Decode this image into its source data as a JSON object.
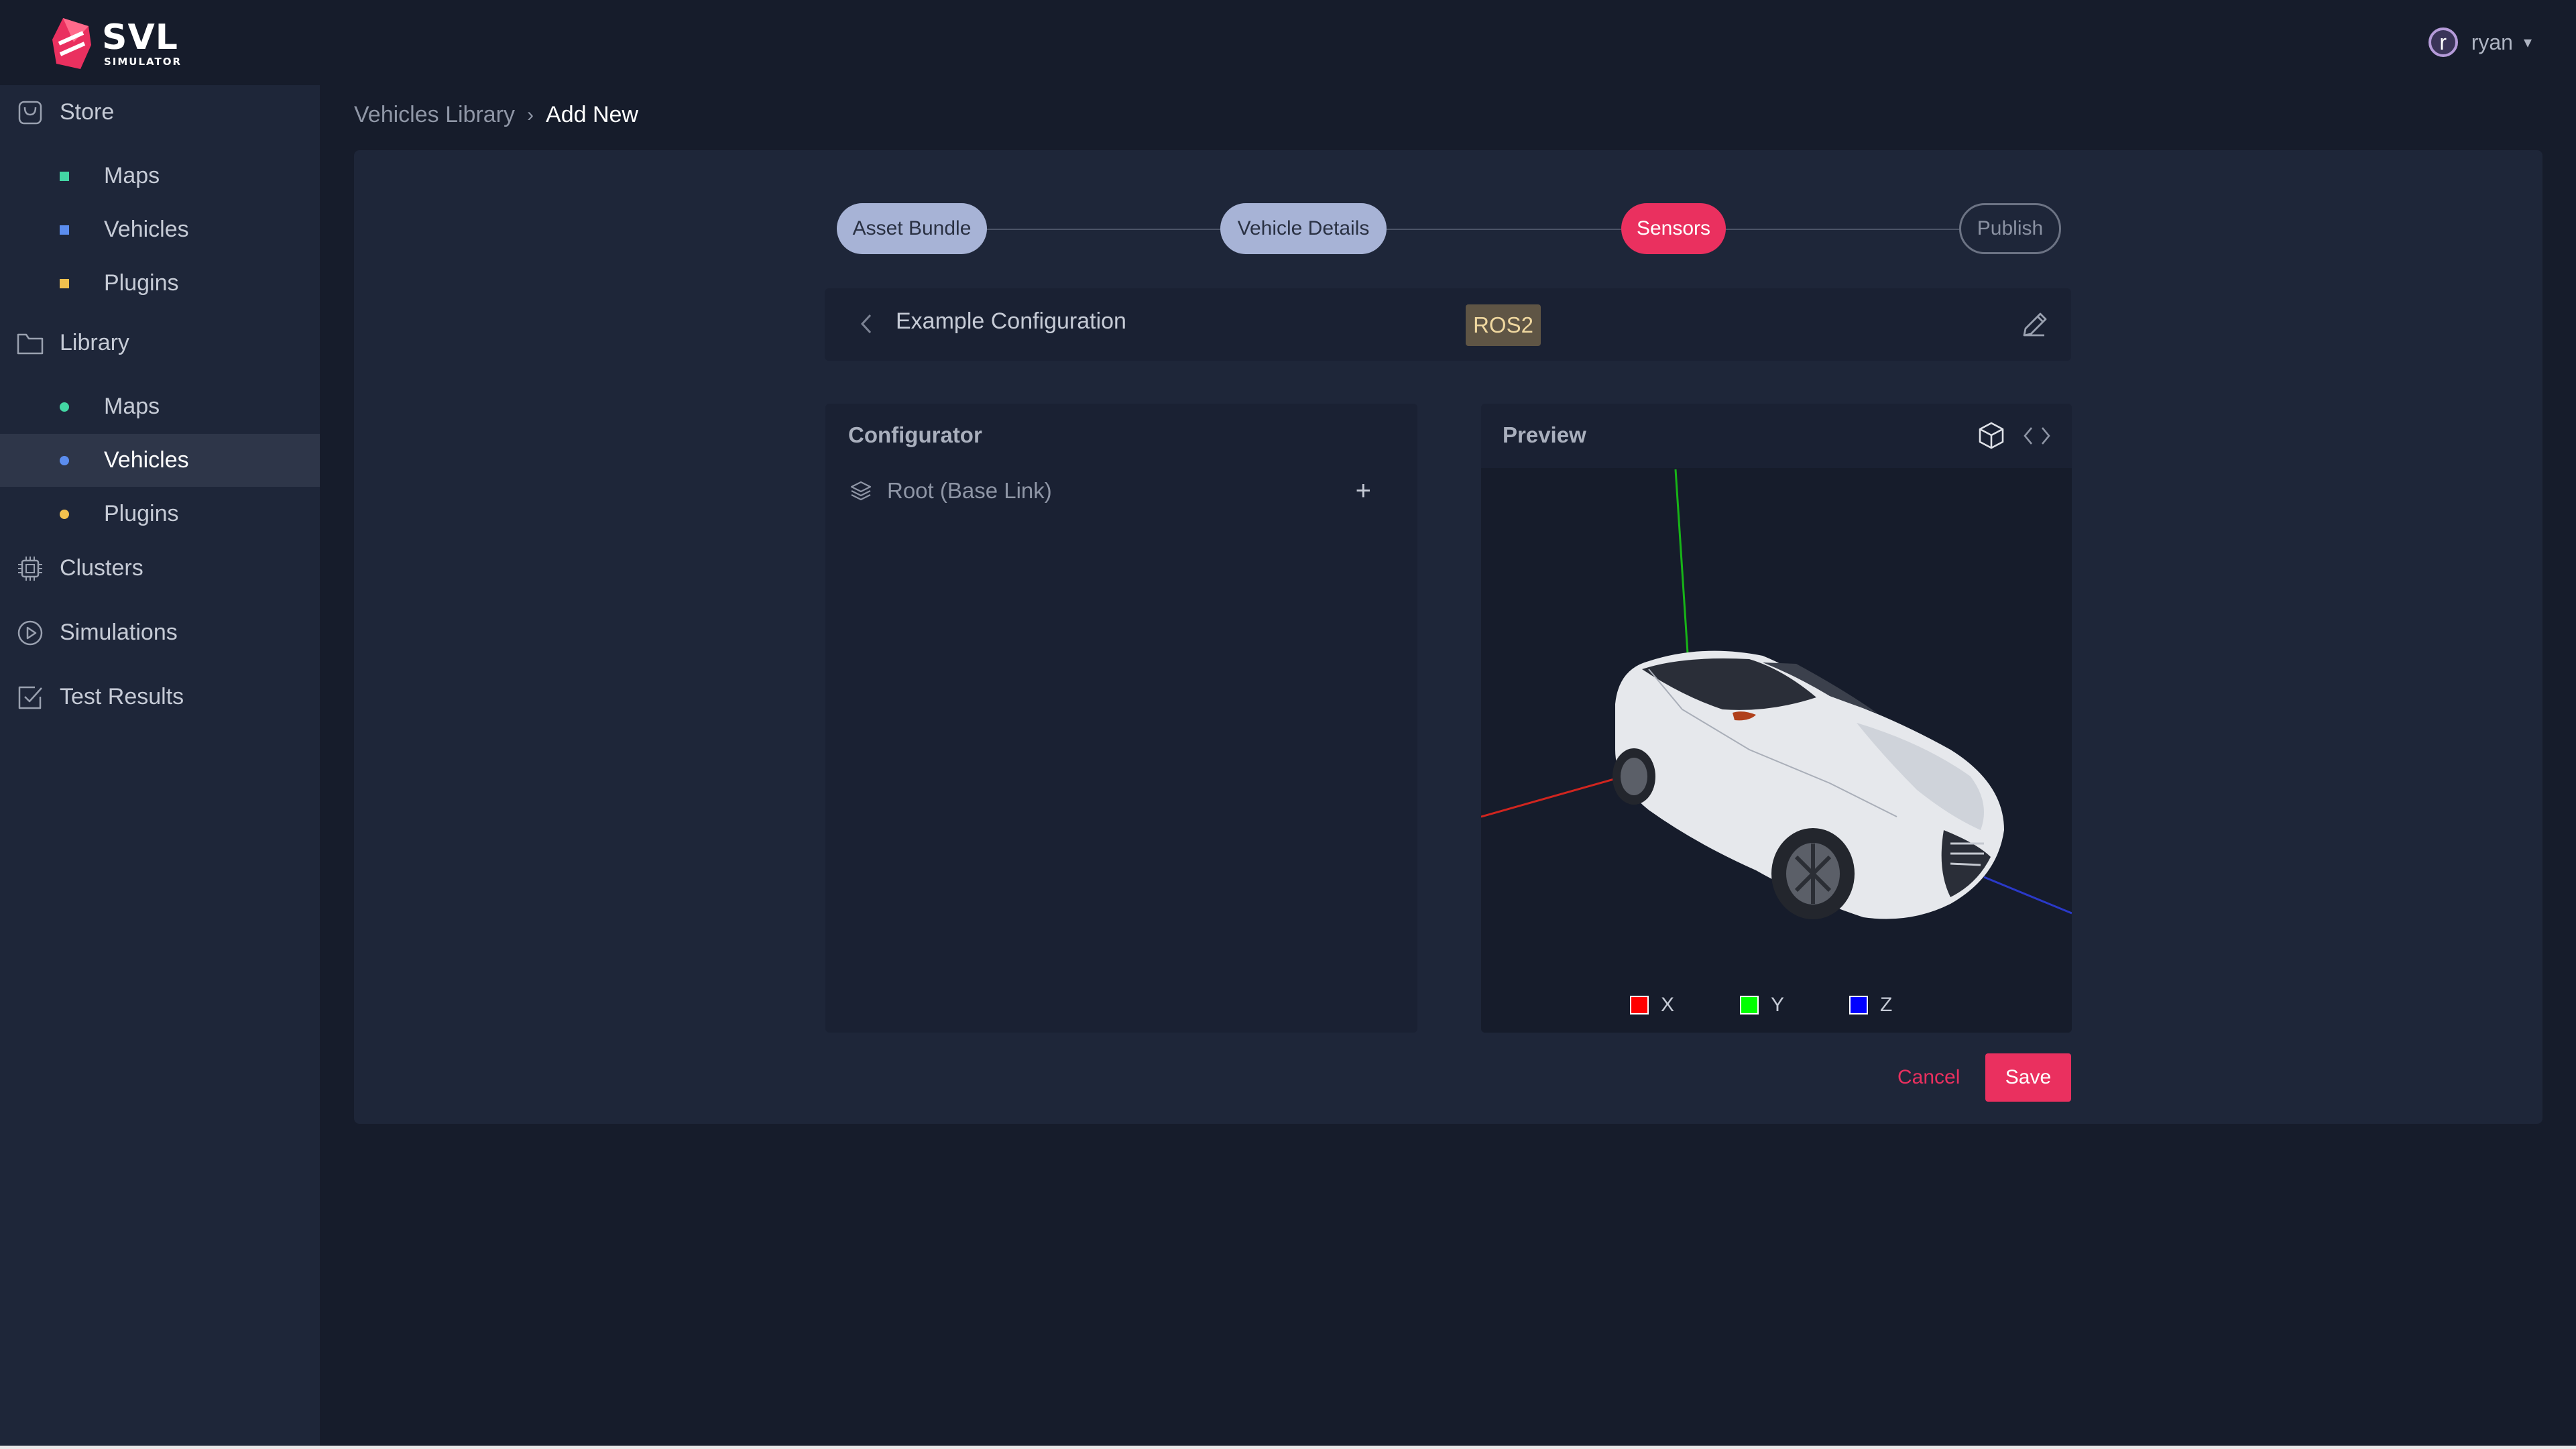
{
  "app": {
    "brand": "SVL",
    "brand_sub": "SIMULATOR",
    "accent_color": "#ea305f"
  },
  "user": {
    "avatar_letter": "r",
    "name": "ryan",
    "caret": "▾"
  },
  "sidebar": {
    "groups": [
      {
        "label": "Store",
        "icon": "store-bag-icon",
        "items": [
          {
            "label": "Maps",
            "bullet_color": "#43d6a4",
            "bullet_shape": "square"
          },
          {
            "label": "Vehicles",
            "bullet_color": "#5b8def",
            "bullet_shape": "square"
          },
          {
            "label": "Plugins",
            "bullet_color": "#f2c14e",
            "bullet_shape": "square"
          }
        ]
      },
      {
        "label": "Library",
        "icon": "folder-icon",
        "items": [
          {
            "label": "Maps",
            "bullet_color": "#43d6a4",
            "bullet_shape": "circle"
          },
          {
            "label": "Vehicles",
            "bullet_color": "#5b8def",
            "bullet_shape": "circle",
            "active": true
          },
          {
            "label": "Plugins",
            "bullet_color": "#f2c14e",
            "bullet_shape": "circle"
          }
        ]
      },
      {
        "label": "Clusters",
        "icon": "cpu-chip-icon"
      },
      {
        "label": "Simulations",
        "icon": "play-circle-icon"
      },
      {
        "label": "Test Results",
        "icon": "checkbox-icon"
      }
    ]
  },
  "breadcrumb": {
    "parent": "Vehicles Library",
    "separator": "›",
    "current": "Add New"
  },
  "stepper": {
    "steps": [
      {
        "label": "Asset Bundle",
        "state": "done"
      },
      {
        "label": "Vehicle Details",
        "state": "done"
      },
      {
        "label": "Sensors",
        "state": "current"
      },
      {
        "label": "Publish",
        "state": "todo"
      }
    ]
  },
  "config": {
    "name": "Example Configuration",
    "bridge_badge": "ROS2"
  },
  "configurator": {
    "title": "Configurator",
    "root_label": "Root (Base Link)",
    "add_symbol": "+"
  },
  "preview": {
    "title": "Preview",
    "legend": [
      {
        "label": "X",
        "color": "#ff0000"
      },
      {
        "label": "Y",
        "color": "#00ff00"
      },
      {
        "label": "Z",
        "color": "#0000ff"
      }
    ]
  },
  "actions": {
    "cancel": "Cancel",
    "save": "Save"
  }
}
